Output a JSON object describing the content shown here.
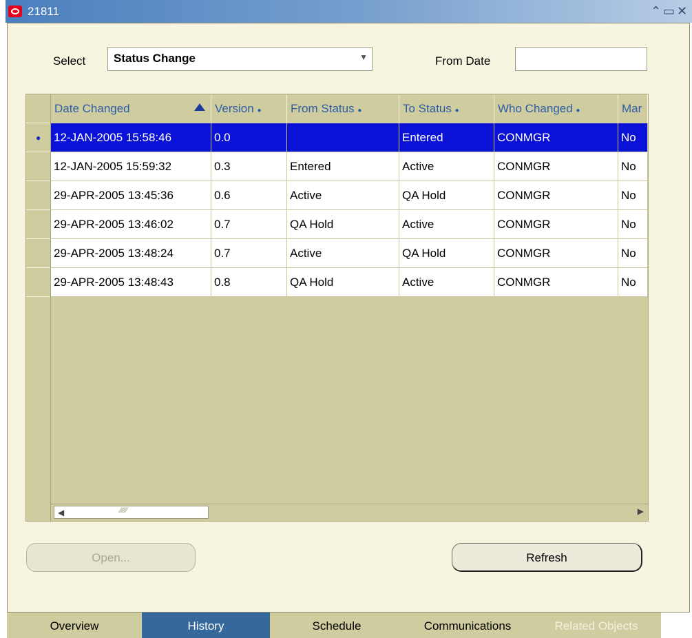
{
  "window": {
    "title": "21811",
    "controls": [
      "⌃",
      "▭",
      "✕"
    ]
  },
  "form": {
    "select_label": "Select",
    "select_value": "Status Change",
    "from_date_label": "From Date",
    "from_date_value": ""
  },
  "table": {
    "columns": [
      "Date Changed",
      "Version",
      "From Status",
      "To Status",
      "Who Changed",
      "Mar"
    ],
    "rows": [
      {
        "date": "12-JAN-2005 15:58:46",
        "version": "0.0",
        "from": "",
        "to": "Entered",
        "who": "CONMGR",
        "manual": "No",
        "selected": true
      },
      {
        "date": "12-JAN-2005 15:59:32",
        "version": "0.3",
        "from": "Entered",
        "to": "Active",
        "who": "CONMGR",
        "manual": "No"
      },
      {
        "date": "29-APR-2005 13:45:36",
        "version": "0.6",
        "from": "Active",
        "to": "QA Hold",
        "who": "CONMGR",
        "manual": "No"
      },
      {
        "date": "29-APR-2005 13:46:02",
        "version": "0.7",
        "from": "QA Hold",
        "to": "Active",
        "who": "CONMGR",
        "manual": "No"
      },
      {
        "date": "29-APR-2005 13:48:24",
        "version": "0.7",
        "from": "Active",
        "to": "QA Hold",
        "who": "CONMGR",
        "manual": "No"
      },
      {
        "date": "29-APR-2005 13:48:43",
        "version": "0.8",
        "from": "QA Hold",
        "to": "Active",
        "who": "CONMGR",
        "manual": "No"
      }
    ]
  },
  "buttons": {
    "open": "Open...",
    "refresh": "Refresh"
  },
  "tabs": [
    {
      "label": "Overview",
      "state": "normal"
    },
    {
      "label": "History",
      "state": "active"
    },
    {
      "label": "Schedule",
      "state": "normal"
    },
    {
      "label": "Communications",
      "state": "normal"
    },
    {
      "label": "Related Objects",
      "state": "disabled"
    }
  ],
  "colors": {
    "title_bar": "#4a7fbe",
    "selection": "#0a12d8",
    "panel": "#f7f4e0",
    "grid_header": "#cfcc9f",
    "active_tab": "#36689c"
  }
}
